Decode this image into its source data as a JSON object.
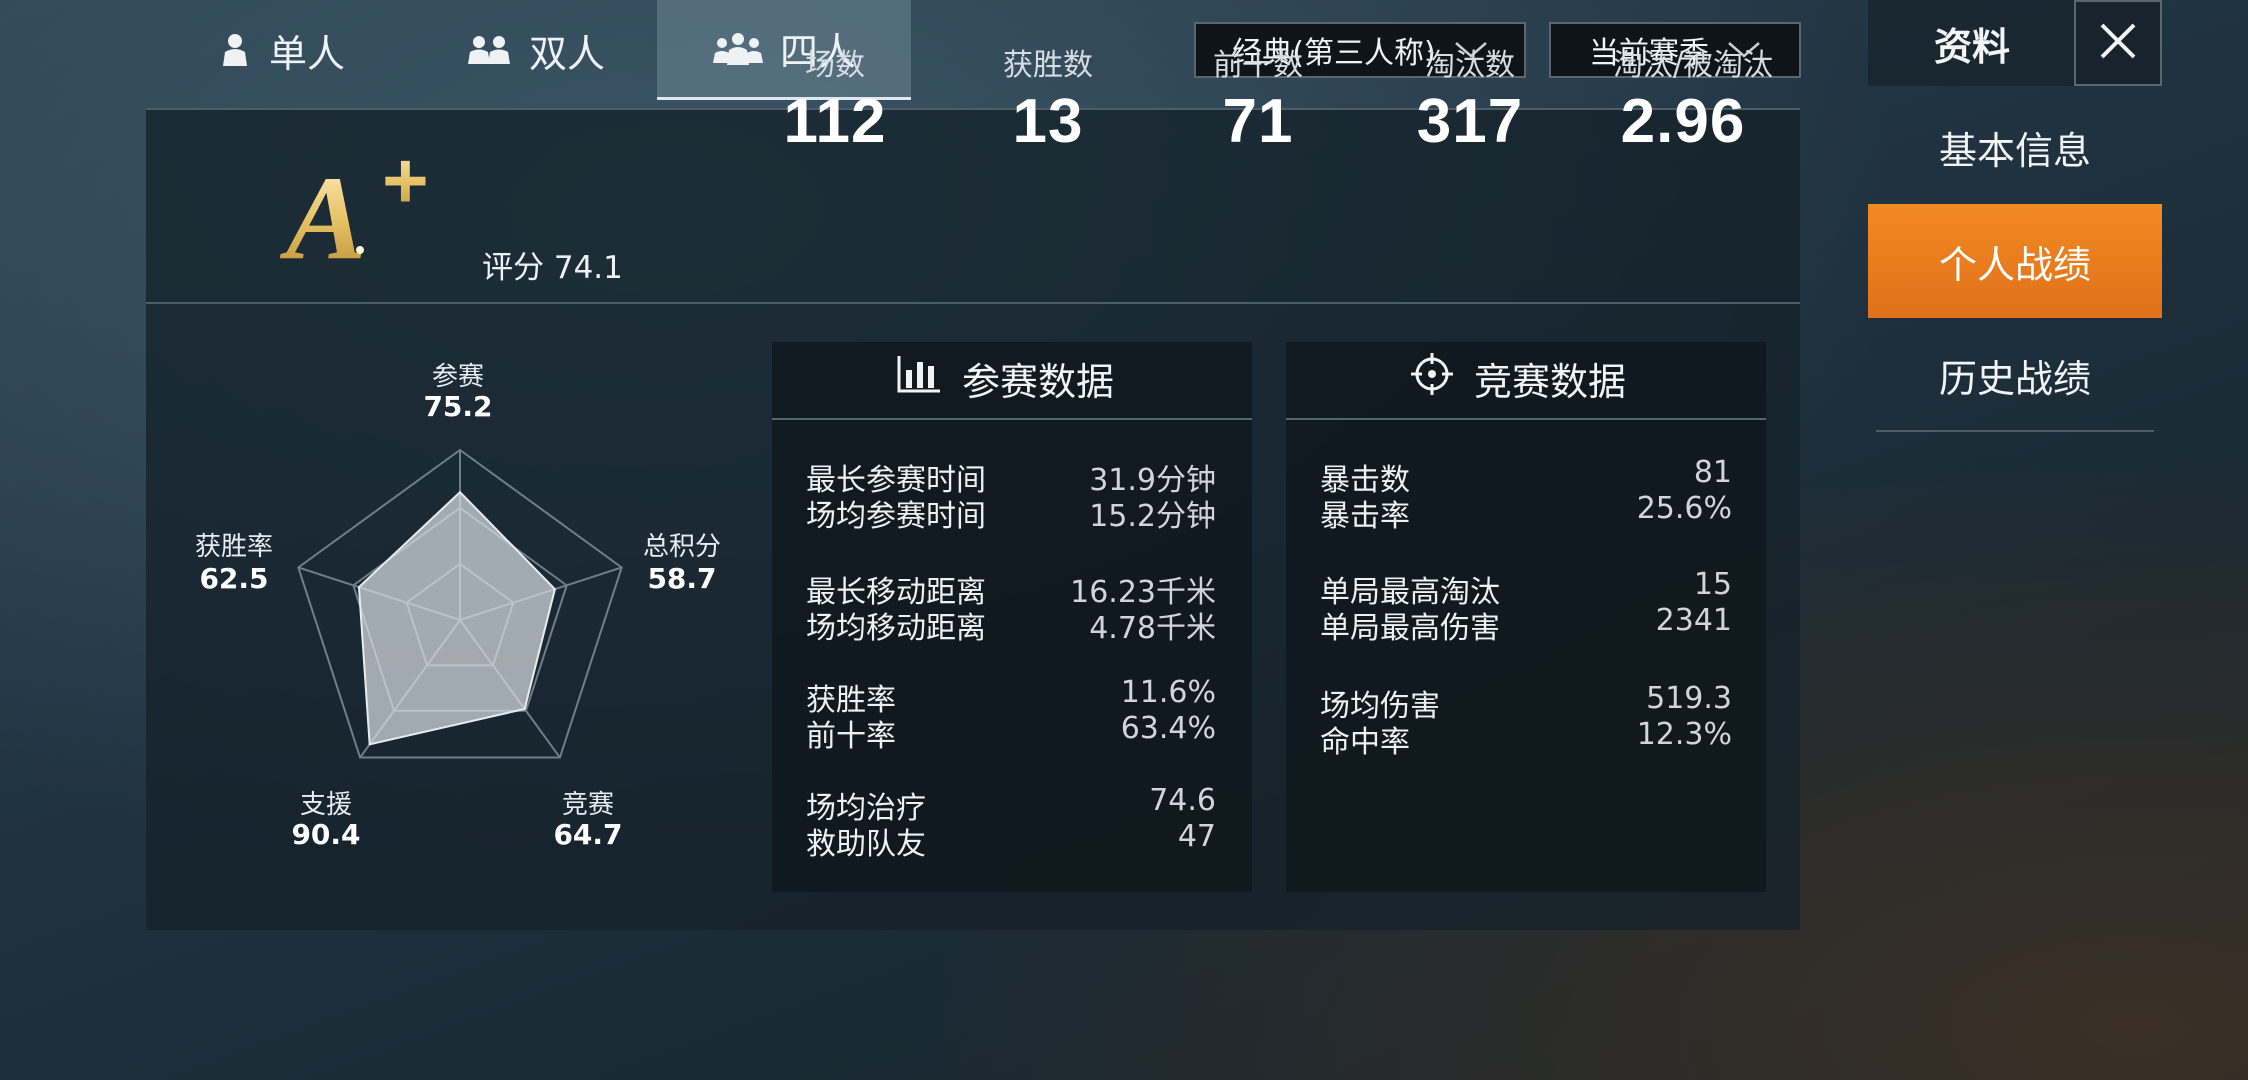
{
  "tabs": [
    {
      "label": "单人",
      "icon": "single-player-icon"
    },
    {
      "label": "双人",
      "icon": "duo-icon"
    },
    {
      "label": "四人",
      "icon": "squad-icon"
    }
  ],
  "dropdowns": {
    "mode": "经典(第三人称)",
    "season": "当前赛季"
  },
  "header": {
    "profile_label": "资料",
    "close_icon": "close-icon"
  },
  "grade": {
    "letter": "A+",
    "score_label": "评分 74.1"
  },
  "summary_stats": [
    {
      "label": "场数",
      "value": "112"
    },
    {
      "label": "获胜数",
      "value": "13"
    },
    {
      "label": "前十数",
      "value": "71"
    },
    {
      "label": "淘汰数",
      "value": "317"
    },
    {
      "label": "淘汰/被淘汰",
      "value": "2.96"
    }
  ],
  "radar": {
    "axes": [
      {
        "label": "参赛",
        "value": "75.2"
      },
      {
        "label": "总积分",
        "value": "58.7"
      },
      {
        "label": "竞赛",
        "value": "64.7"
      },
      {
        "label": "支援",
        "value": "90.4"
      },
      {
        "label": "获胜率",
        "value": "62.5"
      }
    ]
  },
  "participation": {
    "title": "参赛数据",
    "icon": "bar-chart-icon",
    "rows": [
      {
        "label": "最长参赛时间",
        "value": "31.9分钟"
      },
      {
        "label": "场均参赛时间",
        "value": "15.2分钟"
      },
      {
        "label": "最长移动距离",
        "value": "16.23千米"
      },
      {
        "label": "场均移动距离",
        "value": "4.78千米"
      },
      {
        "label": "获胜率",
        "value": "11.6%"
      },
      {
        "label": "前十率",
        "value": "63.4%"
      },
      {
        "label": "场均治疗",
        "value": "74.6"
      },
      {
        "label": "救助队友",
        "value": "47"
      }
    ]
  },
  "competition": {
    "title": "竞赛数据",
    "icon": "crosshair-icon",
    "rows": [
      {
        "label": "暴击数",
        "value": "81"
      },
      {
        "label": "暴击率",
        "value": "25.6%"
      },
      {
        "label": "单局最高淘汰",
        "value": "15"
      },
      {
        "label": "单局最高伤害",
        "value": "2341"
      },
      {
        "label": "场均伤害",
        "value": "519.3"
      },
      {
        "label": "命中率",
        "value": "12.3%"
      }
    ]
  },
  "side_menu": [
    {
      "label": "基本信息",
      "active": false
    },
    {
      "label": "个人战绩",
      "active": true
    },
    {
      "label": "历史战绩",
      "active": false
    }
  ],
  "colors": {
    "accent": "#f28a22",
    "grade_gold": "#e8c46a"
  }
}
